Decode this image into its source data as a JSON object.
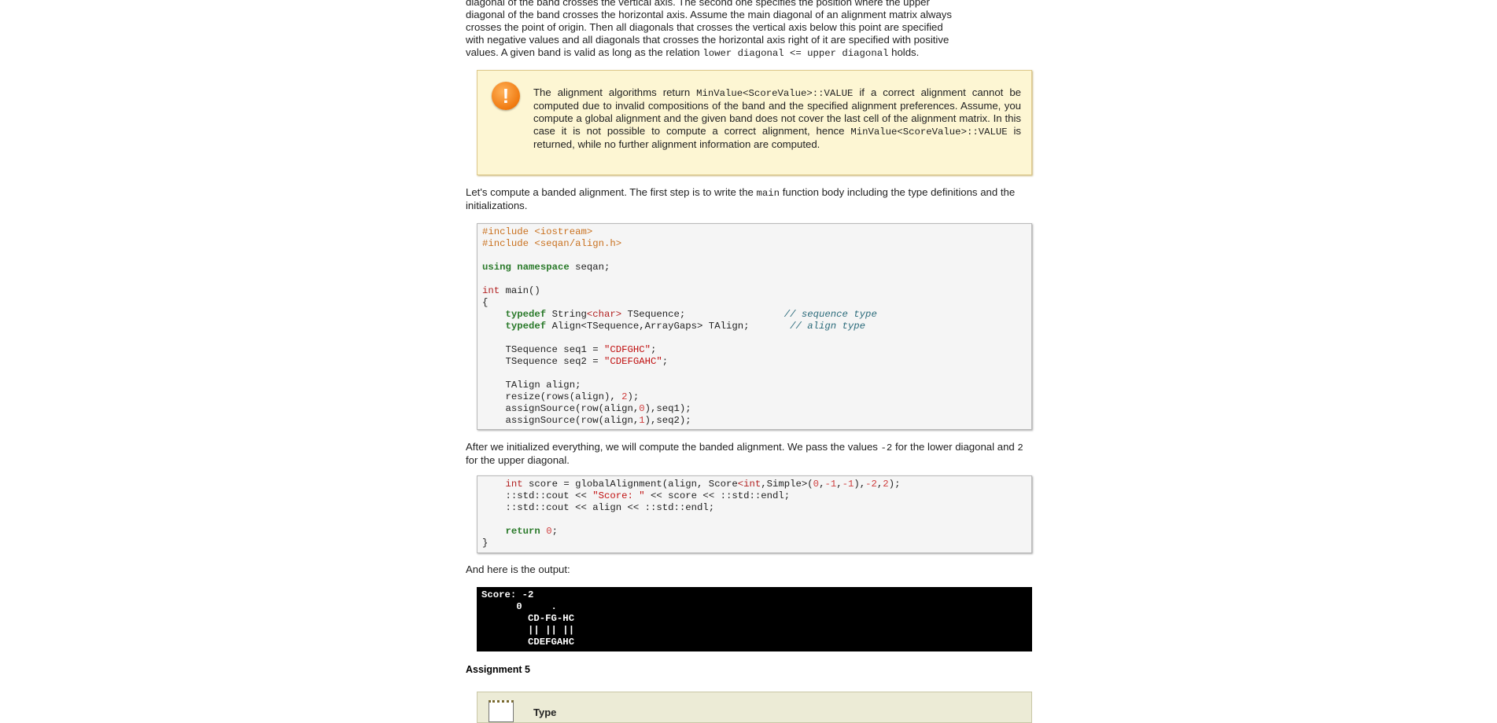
{
  "intro": {
    "line1": "diagonal of the band crosses the vertical axis. The second one specifies the position where the upper",
    "line2": "diagonal of the band crosses the horizontal axis. Assume the main diagonal of an alignment matrix always",
    "line3": "crosses the point of origin. Then all diagonals that crosses the vertical axis below this point are specified",
    "line4": "with negative values and all diagonals that crosses the horizontal axis right of it are specified with positive",
    "line5_pre": "values. A given band is valid as long as the relation ",
    "line5_code": "lower diagonal <= upper diagonal",
    "line5_post": " holds."
  },
  "warning": {
    "icon": "exclamation-icon",
    "icon_glyph": "!",
    "t1": "The alignment algorithms return ",
    "c1": "MinValue<ScoreValue>::VALUE",
    "t2": " if a correct alignment cannot be computed due to invalid compositions of the band and the specified alignment preferences. Assume, you compute a global alignment and the given band does not cover the last cell of the alignment matrix. In this case it is not possible to compute a correct alignment, hence ",
    "c2": "MinValue<ScoreValue>::VALUE",
    "t3": " is returned, while no further alignment information are computed."
  },
  "para2": {
    "pre": "Let's compute a banded alignment. The first step is to write the ",
    "code": "main",
    "post": " function body including the type definitions and the initializations."
  },
  "code1": {
    "l1": "#include <iostream>",
    "l2": "#include <seqan/align.h>",
    "l4a": "using",
    "l4b": "namespace",
    "l4c": " seqan;",
    "l6a": "int",
    "l6b": " main()",
    "l7": "{",
    "l8a": "    ",
    "l8b": "typedef",
    "l8c": " String",
    "l8d": "<char>",
    "l8e": " TSequence;                 ",
    "l8f": "// sequence type",
    "l9a": "    ",
    "l9b": "typedef",
    "l9c": " Align<TSequence,ArrayGaps> TAlign;       ",
    "l9d": "// align type",
    "l11a": "    TSequence seq1 = ",
    "l11b": "\"CDFGHC\"",
    "l11c": ";",
    "l12a": "    TSequence seq2 = ",
    "l12b": "\"CDEFGAHC\"",
    "l12c": ";",
    "l14": "    TAlign align;",
    "l15a": "    resize(rows(align), ",
    "l15b": "2",
    "l15c": ");",
    "l16a": "    assignSource(row(align,",
    "l16b": "0",
    "l16c": "),seq1);",
    "l17a": "    assignSource(row(align,",
    "l17b": "1",
    "l17c": "),seq2);"
  },
  "para3": {
    "pre": "After we initialized everything, we will compute the banded alignment. We pass the values ",
    "c1": "-2",
    "mid": " for the lower diagonal and ",
    "c2": "2",
    "post": " for the upper diagonal."
  },
  "code2": {
    "l1a": "    ",
    "l1b": "int",
    "l1c": " score = globalAlignment(align, Score",
    "l1d": "<int",
    "l1e": ",Simple>(",
    "l1f": "0",
    "l1g": ",",
    "l1h": "-1",
    "l1i": ",",
    "l1j": "-1",
    "l1k": "),",
    "l1l": "-2",
    "l1m": ",",
    "l1n": "2",
    "l1o": ");",
    "l2a": "    ::std::cout << ",
    "l2b": "\"Score: \"",
    "l2c": " << score << ::std::endl;",
    "l3": "    ::std::cout << align << ::std::endl;",
    "l5a": "    ",
    "l5b": "return",
    "l5c": " ",
    "l5d": "0",
    "l5e": ";",
    "l6": "}"
  },
  "para4": "And here is the output:",
  "output": {
    "l1": "Score: -2",
    "l2": "      0     .",
    "l3": "        CD-FG-HC",
    "l4": "        || || ||",
    "l5": "        CDEFGAHC"
  },
  "assignment": {
    "heading": "Assignment 5",
    "icon": "notepad-icon",
    "type_label": "Type"
  }
}
